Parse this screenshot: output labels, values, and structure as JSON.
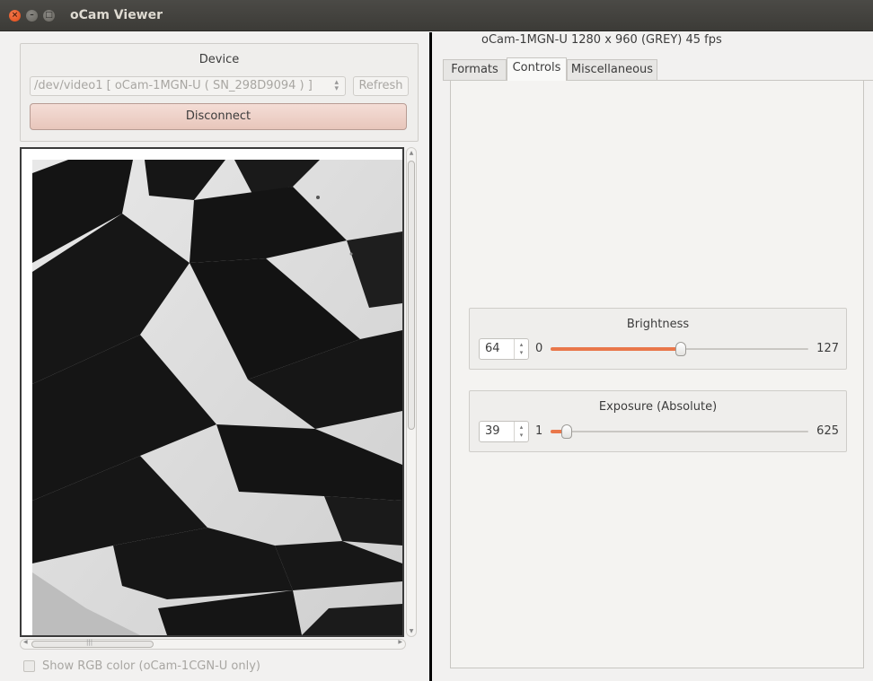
{
  "window": {
    "title": "oCam Viewer",
    "close_glyph": "×",
    "min_glyph": "–",
    "max_glyph": "□"
  },
  "device": {
    "group_title": "Device",
    "selected": "/dev/video1 [ oCam-1MGN-U ( SN_298D9094 ) ]",
    "refresh_label": "Refresh",
    "disconnect_label": "Disconnect"
  },
  "preview": {
    "rgb_checkbox_label": "Show RGB color (oCam-1CGN-U only)",
    "rgb_checked": false
  },
  "camera_info": "oCam-1MGN-U  1280 x 960 (GREY)  45 fps",
  "tabs": [
    {
      "label": "Formats",
      "active": false
    },
    {
      "label": "Controls",
      "active": true
    },
    {
      "label": "Miscellaneous",
      "active": false
    }
  ],
  "controls": [
    {
      "name": "Brightness",
      "value": "64",
      "min": "0",
      "max": "127",
      "fraction": 0.504
    },
    {
      "name": "Exposure (Absolute)",
      "value": "39",
      "min": "1",
      "max": "625",
      "fraction": 0.061
    }
  ],
  "colors": {
    "accent": "#e9774a",
    "titlebar": "#3c3b37",
    "close": "#df4a16",
    "disconnect": "#e8c6bb"
  }
}
